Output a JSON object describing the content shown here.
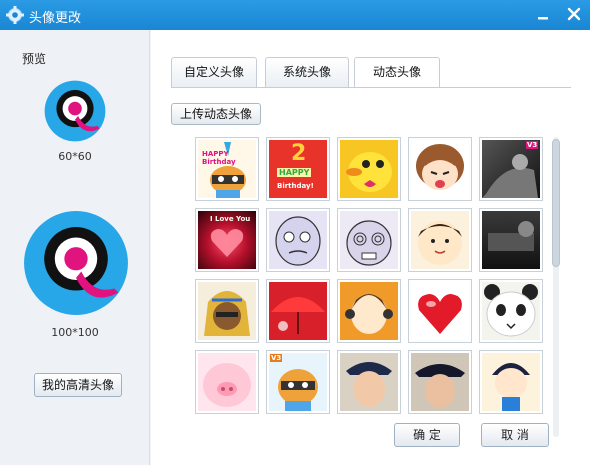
{
  "window": {
    "title": "头像更改"
  },
  "preview": {
    "label": "预览",
    "small_size": "60*60",
    "big_size": "100*100",
    "hd_button": "我的高清头像"
  },
  "tabs": [
    {
      "label": "自定义头像"
    },
    {
      "label": "系统头像"
    },
    {
      "label": "动态头像",
      "active": true
    }
  ],
  "upload_button": "上传动态头像",
  "avatar_texts": {
    "happy_birthday": "HAPPY Birthday",
    "number_two": "2",
    "happy_small": "HAPPY",
    "birthday_small": "Birthday!",
    "v3_a": "V3",
    "i_love_you": "I Love You",
    "v3_b": "V3"
  },
  "footer": {
    "ok": "确 定",
    "cancel": "取 消"
  },
  "colors": {
    "titlebar": "#1a86d4",
    "accent_pink": "#e0137f",
    "logo_blue": "#27a6e8"
  }
}
